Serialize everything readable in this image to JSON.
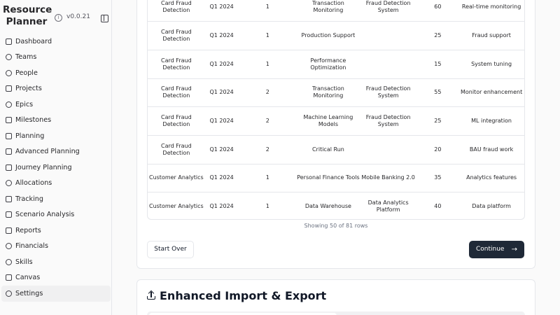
{
  "app": {
    "title": "Resource Planner",
    "version": "v0.0.21"
  },
  "sidebar": {
    "items": [
      {
        "label": "Dashboard",
        "icon": "dashboard-icon"
      },
      {
        "label": "Teams",
        "icon": "users-icon"
      },
      {
        "label": "People",
        "icon": "user-icon"
      },
      {
        "label": "Projects",
        "icon": "folder-icon"
      },
      {
        "label": "Epics",
        "icon": "target-icon"
      },
      {
        "label": "Milestones",
        "icon": "calendar-icon"
      },
      {
        "label": "Planning",
        "icon": "branch-icon"
      },
      {
        "label": "Advanced Planning",
        "icon": "network-icon"
      },
      {
        "label": "Journey Planning",
        "icon": "map-icon"
      },
      {
        "label": "Allocations",
        "icon": "activity-icon"
      },
      {
        "label": "Tracking",
        "icon": "chart-icon"
      },
      {
        "label": "Scenario Analysis",
        "icon": "network-icon"
      },
      {
        "label": "Reports",
        "icon": "bar-chart-icon"
      },
      {
        "label": "Financials",
        "icon": "dollar-icon"
      },
      {
        "label": "Skills",
        "icon": "target-icon"
      },
      {
        "label": "Canvas",
        "icon": "network-icon"
      },
      {
        "label": "Settings",
        "icon": "gear-icon"
      }
    ],
    "active": "Settings"
  },
  "table": {
    "rows": [
      {
        "project": "Card Fraud Detection",
        "quarter": "Q1 2024",
        "iteration": "1",
        "epic": "Transaction Monitoring",
        "system": "Fraud Detection System",
        "allocation": "60",
        "notes": "Real-time monitoring"
      },
      {
        "project": "Card Fraud Detection",
        "quarter": "Q1 2024",
        "iteration": "1",
        "epic": "Production Support",
        "system": "",
        "allocation": "25",
        "notes": "Fraud support"
      },
      {
        "project": "Card Fraud Detection",
        "quarter": "Q1 2024",
        "iteration": "1",
        "epic": "Performance Optimization",
        "system": "",
        "allocation": "15",
        "notes": "System tuning"
      },
      {
        "project": "Card Fraud Detection",
        "quarter": "Q1 2024",
        "iteration": "2",
        "epic": "Transaction Monitoring",
        "system": "Fraud Detection System",
        "allocation": "55",
        "notes": "Monitor enhancement"
      },
      {
        "project": "Card Fraud Detection",
        "quarter": "Q1 2024",
        "iteration": "2",
        "epic": "Machine Learning Models",
        "system": "Fraud Detection System",
        "allocation": "25",
        "notes": "ML integration"
      },
      {
        "project": "Card Fraud Detection",
        "quarter": "Q1 2024",
        "iteration": "2",
        "epic": "Critical Run",
        "system": "",
        "allocation": "20",
        "notes": "BAU fraud work"
      },
      {
        "project": "Customer Analytics",
        "quarter": "Q1 2024",
        "iteration": "1",
        "epic": "Personal Finance Tools",
        "system": "Mobile Banking 2.0",
        "allocation": "35",
        "notes": "Analytics features"
      },
      {
        "project": "Customer Analytics",
        "quarter": "Q1 2024",
        "iteration": "1",
        "epic": "Data Warehouse",
        "system": "Data Analytics Platform",
        "allocation": "40",
        "notes": "Data platform"
      }
    ],
    "showing": "Showing 50 of 81 rows"
  },
  "actions": {
    "start_over": "Start Over",
    "continue": "Continue"
  },
  "section": {
    "title": "Enhanced Import & Export"
  }
}
